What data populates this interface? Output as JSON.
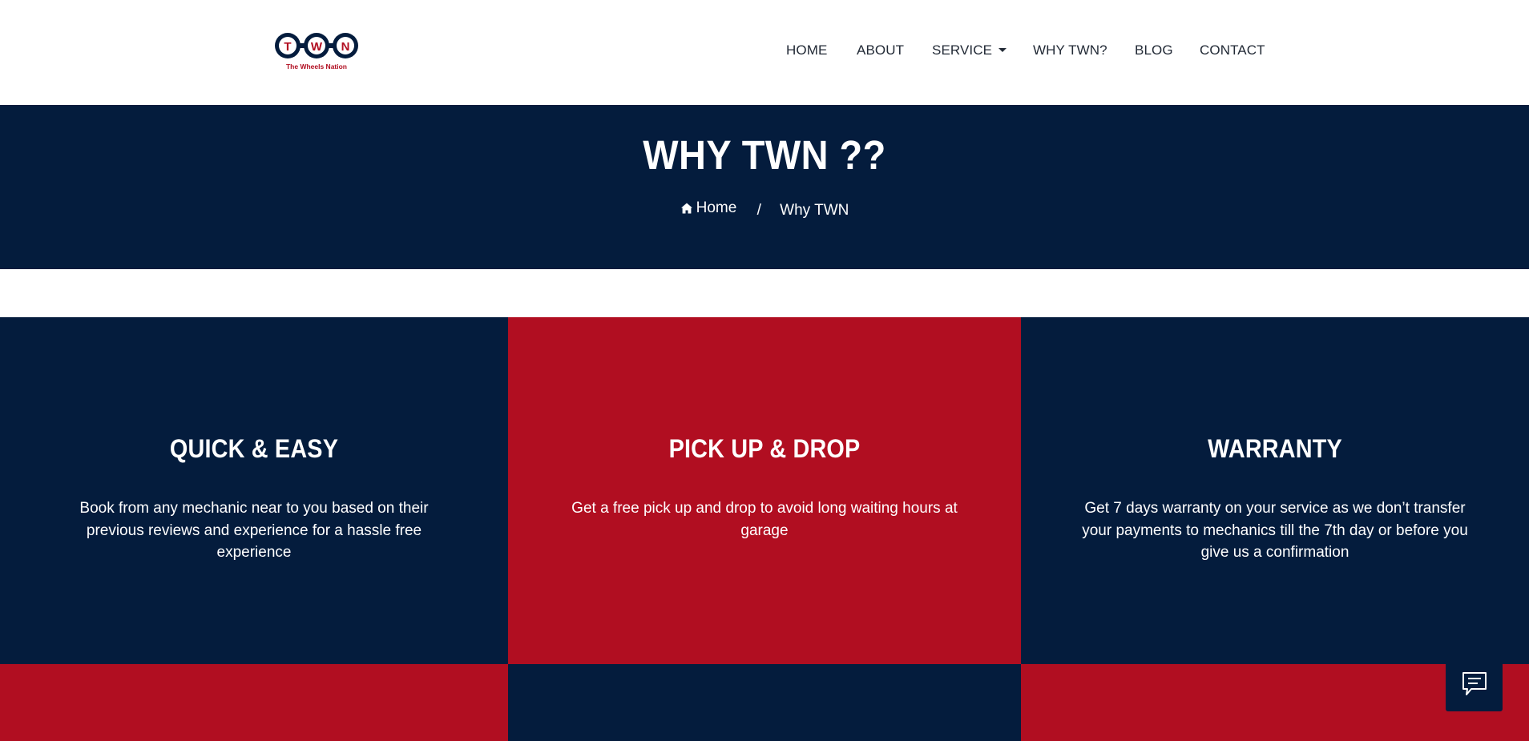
{
  "colors": {
    "navy": "#041c3d",
    "red": "#b10e21",
    "white": "#ffffff",
    "nav_text": "#222a36"
  },
  "logo": {
    "letters": [
      "T",
      "W",
      "N"
    ],
    "tagline": "The Wheels Nation",
    "icon": "twn-logo"
  },
  "nav": {
    "items": [
      {
        "label": "HOME"
      },
      {
        "label": "ABOUT"
      },
      {
        "label": "SERVICE",
        "has_dropdown": true
      },
      {
        "label": "WHY TWN?"
      },
      {
        "label": "BLOG"
      },
      {
        "label": "CONTACT"
      }
    ]
  },
  "banner": {
    "title": "WHY TWN ??",
    "breadcrumb": {
      "home_label": "Home",
      "separator": "/",
      "current": "Why TWN"
    }
  },
  "features": [
    {
      "title": "QUICK & EASY",
      "text": "Book from any mechanic near to you based on their previous reviews and experience for a hassle free experience",
      "bg": "navy"
    },
    {
      "title": "PICK UP & DROP",
      "text": "Get a free pick up and drop to avoid long waiting hours at garage",
      "bg": "red"
    },
    {
      "title": "WARRANTY",
      "text": "Get 7 days warranty on your service as we don’t transfer your payments to mechanics till the 7th day or before you give us a confirmation",
      "bg": "navy"
    }
  ],
  "chat": {
    "icon": "chat-bubble-icon"
  }
}
